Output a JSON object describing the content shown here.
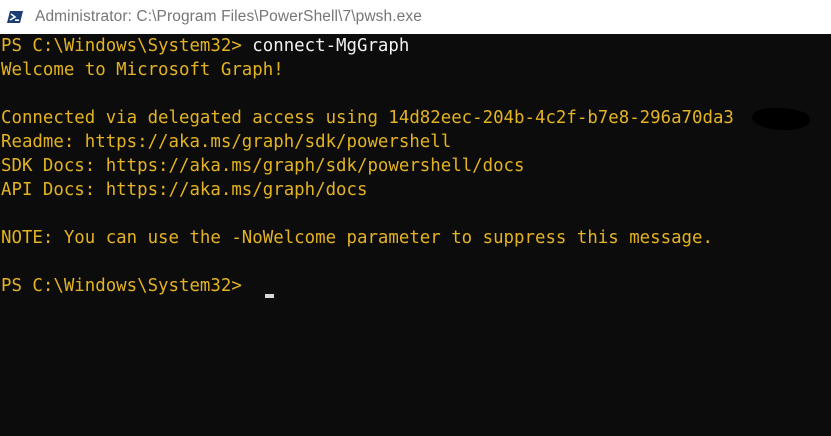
{
  "titlebar": {
    "title": "Administrator: C:\\Program Files\\PowerShell\\7\\pwsh.exe",
    "icon": "powershell-icon"
  },
  "console": {
    "lines": [
      {
        "prompt": "PS C:\\Windows\\System32> ",
        "command": "connect-MgGraph"
      },
      {
        "text": "Welcome to Microsoft Graph!"
      },
      {
        "text": ""
      },
      {
        "text": "Connected via delegated access using 14d82eec-204b-4c2f-b7e8-296a70da3"
      },
      {
        "text": "Readme: https://aka.ms/graph/sdk/powershell"
      },
      {
        "text": "SDK Docs: https://aka.ms/graph/sdk/powershell/docs"
      },
      {
        "text": "API Docs: https://aka.ms/graph/docs"
      },
      {
        "text": ""
      },
      {
        "text": "NOTE: You can use the -NoWelcome parameter to suppress this message."
      },
      {
        "text": ""
      },
      {
        "prompt": "PS C:\\Windows\\System32> ",
        "command": ""
      }
    ]
  },
  "colors": {
    "background": "#0c0c0c",
    "output_text": "#e3b321",
    "command_text": "#f2f2f2",
    "titlebar_bg": "#ffffff",
    "titlebar_text": "#767676",
    "icon_blue": "#1b3f73"
  }
}
